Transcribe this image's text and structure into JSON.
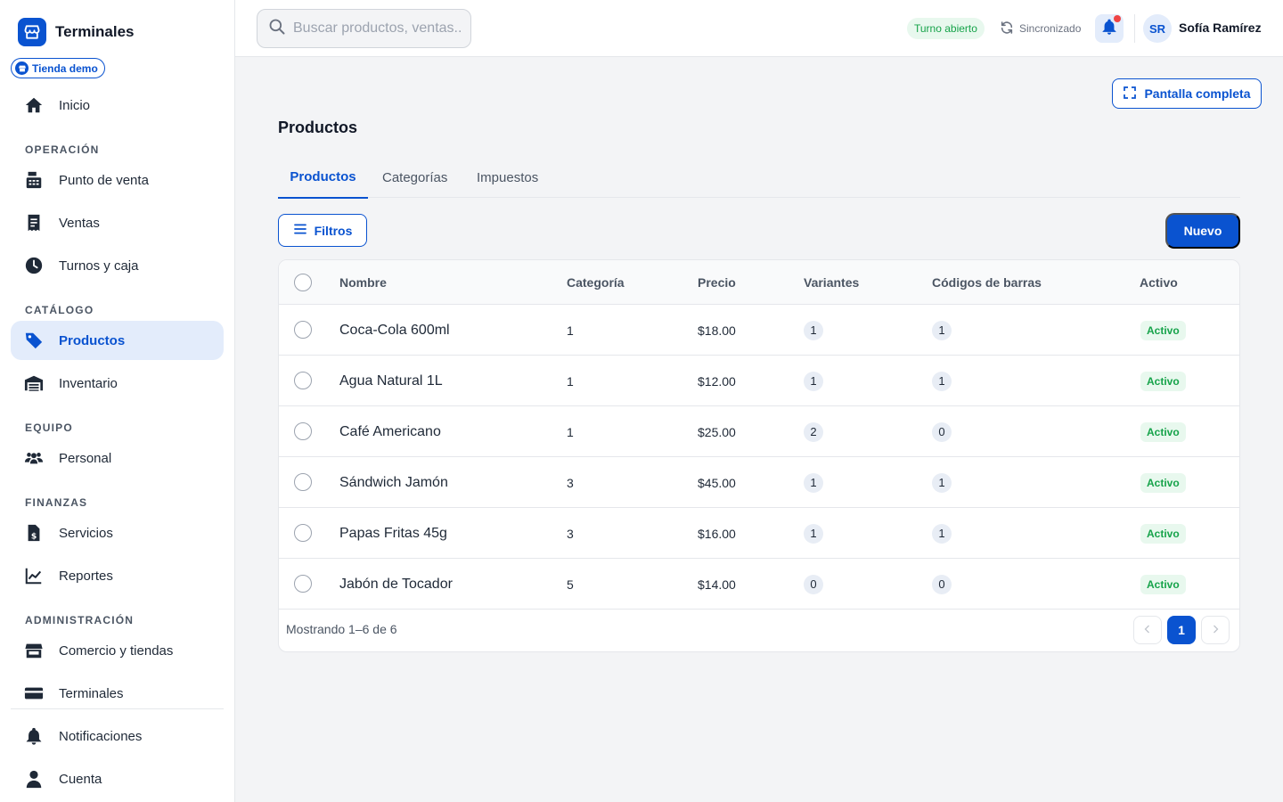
{
  "brand": {
    "title": "Terminales",
    "store": "Tienda demo"
  },
  "sidebar": {
    "home": "Inicio",
    "sections": {
      "operacion": "OPERACIÓN",
      "catalogo": "CATÁLOGO",
      "equipo": "EQUIPO",
      "finanzas": "FINANZAS",
      "administracion": "ADMINISTRACIÓN"
    },
    "items": {
      "pos": "Punto de venta",
      "ventas": "Ventas",
      "turnos": "Turnos y caja",
      "productos": "Productos",
      "inventario": "Inventario",
      "personal": "Personal",
      "servicios": "Servicios",
      "reportes": "Reportes",
      "comercio": "Comercio y tiendas",
      "terminales": "Terminales",
      "notificaciones": "Notificaciones",
      "cuenta": "Cuenta"
    }
  },
  "header": {
    "search_placeholder": "Buscar productos, ventas...",
    "shift_status": "Turno abierto",
    "sync_status": "Sincronizado",
    "user_initials": "SR",
    "user_name": "Sofía Ramírez"
  },
  "main": {
    "fullscreen_label": "Pantalla completa",
    "title": "Productos",
    "tabs": [
      "Productos",
      "Categorías",
      "Impuestos"
    ],
    "filters_label": "Filtros",
    "new_label": "Nuevo"
  },
  "table": {
    "columns": [
      "Nombre",
      "Categoría",
      "Precio",
      "Variantes",
      "Códigos de barras",
      "Activo"
    ],
    "rows": [
      {
        "name": "Coca-Cola 600ml",
        "category": "1",
        "price": "$18.00",
        "variants": "1",
        "barcodes": "1",
        "status": "Activo"
      },
      {
        "name": "Agua Natural 1L",
        "category": "1",
        "price": "$12.00",
        "variants": "1",
        "barcodes": "1",
        "status": "Activo"
      },
      {
        "name": "Café Americano",
        "category": "1",
        "price": "$25.00",
        "variants": "2",
        "barcodes": "0",
        "status": "Activo"
      },
      {
        "name": "Sándwich Jamón",
        "category": "3",
        "price": "$45.00",
        "variants": "1",
        "barcodes": "1",
        "status": "Activo"
      },
      {
        "name": "Papas Fritas 45g",
        "category": "3",
        "price": "$16.00",
        "variants": "1",
        "barcodes": "1",
        "status": "Activo"
      },
      {
        "name": "Jabón de Tocador",
        "category": "5",
        "price": "$14.00",
        "variants": "0",
        "barcodes": "0",
        "status": "Activo"
      }
    ],
    "footer": "Mostrando 1–6 de 6",
    "current_page": "1"
  },
  "colors": {
    "accent": "#0a53d0",
    "success": "#16a34a",
    "danger": "#ef4444"
  }
}
